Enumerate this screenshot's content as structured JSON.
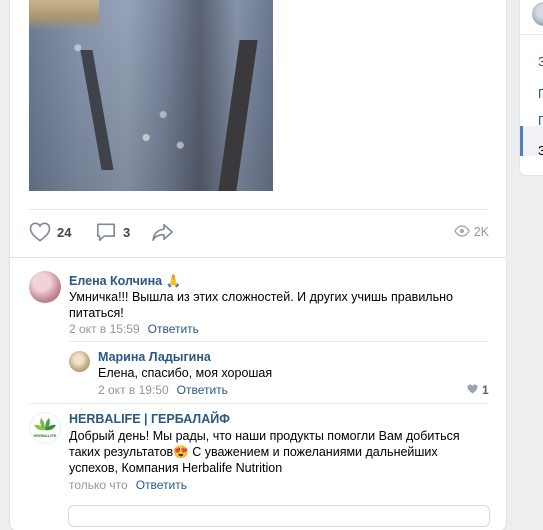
{
  "post": {
    "likes": "24",
    "comments": "3",
    "views": "2K"
  },
  "comments": [
    {
      "author": "Елена Колчина 🙏",
      "text": "Умничка!!! Вышла из этих сложностей. И других учишь правильно питаться!",
      "time": "2 окт в 15:59",
      "reply_label": "Ответить"
    },
    {
      "author": "Марина Ладыгина",
      "text": "Елена, спасибо, моя хорошая",
      "time": "2 окт в 19:50",
      "reply_label": "Ответить",
      "likes": "1"
    },
    {
      "author": "HERBALIFE | ГЕРБАЛАЙФ",
      "text": "Добрый день! Мы рады, что наши продукты помогли Вам добиться таких результатов😍 С уважением и пожеланиями дальнейших успехов, Компания Herbalife Nutrition",
      "time": "только что",
      "reply_label": "Ответить",
      "avatar_text": "HERBALIFE"
    }
  ],
  "sidebar": {
    "items": [
      "З",
      "Г",
      "Г",
      "З"
    ]
  },
  "colors": {
    "link": "#2a5885",
    "muted": "#939699",
    "accent": "#5181b8"
  },
  "icons": [
    "heart-icon",
    "comment-icon",
    "share-icon",
    "eye-icon",
    "small-heart-icon",
    "herbalife-leaf-icon"
  ]
}
